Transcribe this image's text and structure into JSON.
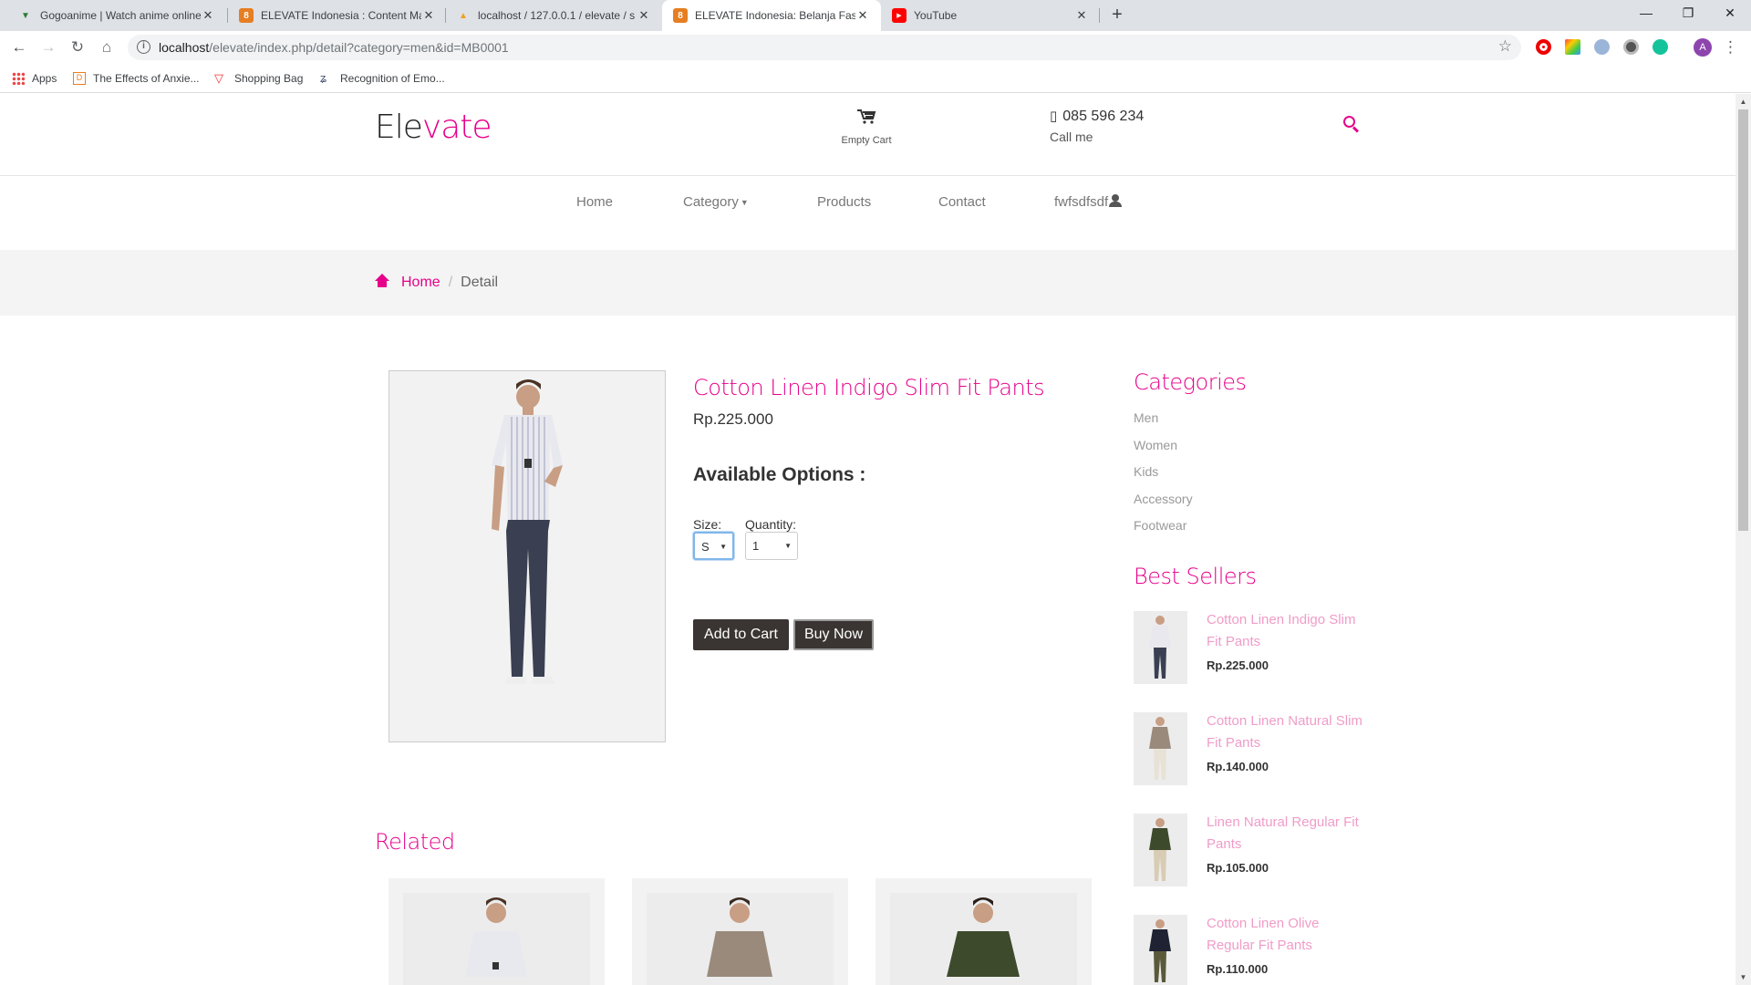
{
  "browser": {
    "tabs": [
      {
        "title": "Gogoanime | Watch anime online",
        "favicon": "gogoanime-icon",
        "fav_color": "#2e7d32"
      },
      {
        "title": "ELEVATE Indonesia : Content Man",
        "favicon": "elevate-icon",
        "fav_color": "#e67e22"
      },
      {
        "title": "localhost / 127.0.0.1 / elevate / s",
        "favicon": "phpmyadmin-icon",
        "fav_color": "#f0a020"
      },
      {
        "title": "ELEVATE Indonesia: Belanja Fashi",
        "favicon": "elevate-icon",
        "fav_color": "#e67e22"
      },
      {
        "title": "YouTube",
        "favicon": "youtube-icon",
        "fav_color": "#ff0000"
      }
    ],
    "url_host": "localhost",
    "url_path": "/elevate/index.php/detail?category=men&id=MB0001",
    "bookmarks": [
      {
        "label": "Apps",
        "icon": "apps-grid-icon"
      },
      {
        "label": "The Effects of Anxie...",
        "icon": "bookmark-d-icon"
      },
      {
        "label": "Shopping Bag",
        "icon": "vivaldi-icon"
      },
      {
        "label": "Recognition of Emo...",
        "icon": "link-icon"
      }
    ],
    "profile_initial": "A"
  },
  "site": {
    "logo_dark": "Ele",
    "logo_pink": "vate",
    "cart_label": "Empty Cart",
    "phone": "085 596 234",
    "phone_sub": "Call me",
    "accent": "#e6008a",
    "nav": {
      "home": "Home",
      "category": "Category",
      "products": "Products",
      "contact": "Contact",
      "user": "fwfsdfsdf"
    },
    "breadcrumb": {
      "home": "Home",
      "separator": "/",
      "current": "Detail"
    }
  },
  "product": {
    "title": "Cotton Linen Indigo Slim Fit Pants",
    "price": "Rp.225.000",
    "options_title": "Available Options :",
    "size_label": "Size:",
    "size_value": "S",
    "qty_label": "Quantity:",
    "qty_value": "1",
    "add_to_cart": "Add to Cart",
    "buy_now": "Buy Now"
  },
  "related": {
    "title": "Related"
  },
  "sidebar": {
    "categories_title": "Categories",
    "categories": [
      "Men",
      "Women",
      "Kids",
      "Accessory",
      "Footwear"
    ],
    "best_sellers_title": "Best Sellers",
    "best_sellers": [
      {
        "name": "Cotton Linen Indigo Slim Fit Pants",
        "price": "Rp.225.000",
        "shirt": "#e8e8ee",
        "pants": "#3a3f52"
      },
      {
        "name": "Cotton Linen Natural Slim Fit Pants",
        "price": "Rp.140.000",
        "shirt": "#9a8a7c",
        "pants": "#e8e2d6"
      },
      {
        "name": "Linen Natural Regular Fit Pants",
        "price": "Rp.105.000",
        "shirt": "#3d4a2c",
        "pants": "#d8ccb4"
      },
      {
        "name": "Cotton Linen Olive Regular Fit Pants",
        "price": "Rp.110.000",
        "shirt": "#1e2233",
        "pants": "#5a5a3a"
      }
    ]
  }
}
